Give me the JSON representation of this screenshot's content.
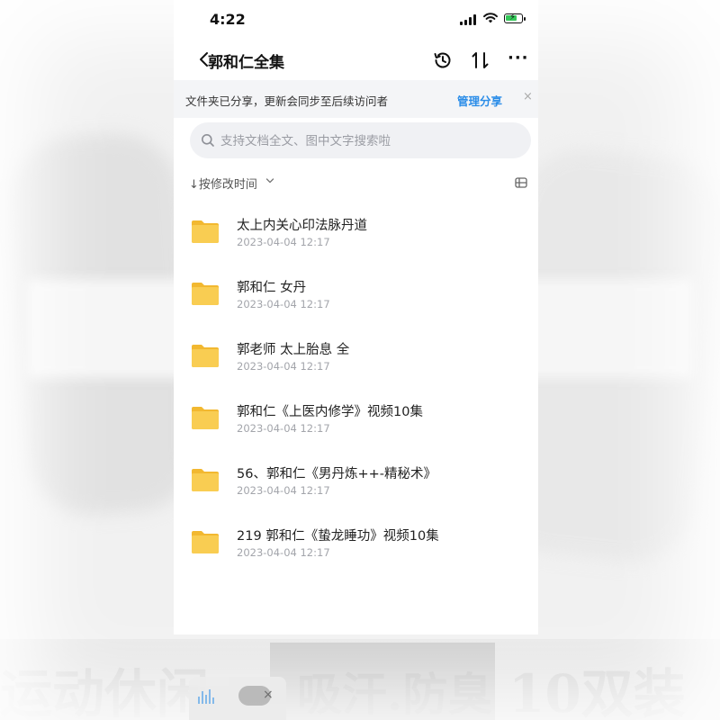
{
  "status_bar": {
    "time": "4:22"
  },
  "nav": {
    "title": "郭和仁全集"
  },
  "share_notice": {
    "text": "文件夹已分享，更新会同步至后续访问者",
    "action": "管理分享",
    "close": "×"
  },
  "search": {
    "placeholder": "支持文档全文、图中文字搜索啦"
  },
  "sort": {
    "label": "↓按修改时间"
  },
  "files": [
    {
      "name": "太上内关心印法脉丹道",
      "date": "2023-04-04 12:17",
      "icon": "folder-icon"
    },
    {
      "name": "郭和仁 女丹",
      "date": "2023-04-04 12:17",
      "icon": "folder-icon"
    },
    {
      "name": "郭老师 太上胎息 全",
      "date": "2023-04-04 12:17",
      "icon": "folder-icon"
    },
    {
      "name": "郭和仁《上医内修学》视频10集",
      "date": "2023-04-04 12:17",
      "icon": "folder-icon"
    },
    {
      "name": "56、郭和仁《男丹炼++-精秘术》",
      "date": "2023-04-04 12:17",
      "icon": "folder-icon"
    },
    {
      "name": "219 郭和仁《蛰龙睡功》视频10集",
      "date": "2023-04-04 12:17",
      "icon": "folder-icon"
    }
  ],
  "background_banner": {
    "left": "运动休闲",
    "middle": "吸汗.防臭",
    "right": "10双装"
  },
  "floating_widget": {
    "close": "×"
  },
  "colors": {
    "accent": "#2b8de8",
    "folder": "#f7c544",
    "battery": "#34c759"
  }
}
